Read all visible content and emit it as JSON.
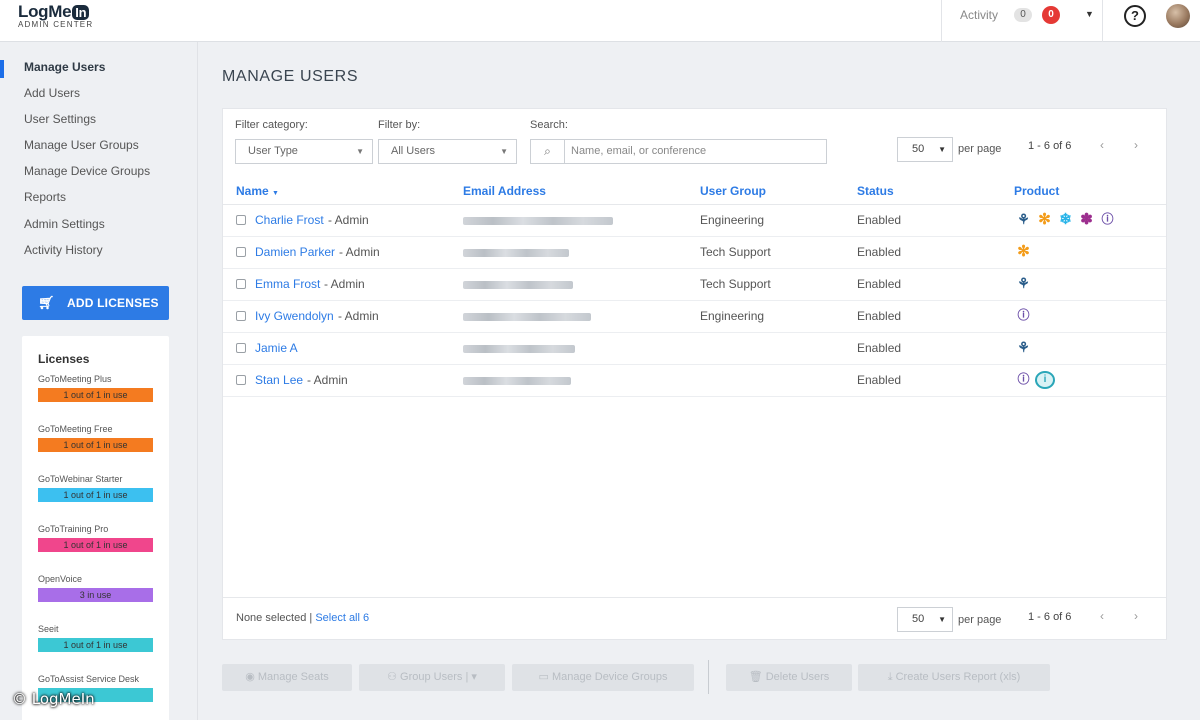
{
  "app": {
    "logo_main": "LogMe",
    "logo_in": "In",
    "logo_sub": "ADMIN CENTER"
  },
  "header": {
    "activity_label": "Activity",
    "activity_count": "0",
    "alert_count": "0",
    "help_glyph": "?"
  },
  "sidebar": {
    "items": [
      {
        "label": "Manage Users"
      },
      {
        "label": "Add Users"
      },
      {
        "label": "User Settings"
      },
      {
        "label": "Manage User Groups"
      },
      {
        "label": "Manage Device Groups"
      },
      {
        "label": "Reports"
      },
      {
        "label": "Admin Settings"
      },
      {
        "label": "Activity History"
      }
    ],
    "active_index": 0,
    "add_licenses_label": "ADD LICENSES"
  },
  "licenses": {
    "title": "Licenses",
    "items": [
      {
        "name": "GoToMeeting Plus",
        "usage": "1 out of 1 in use",
        "color": "#f47b20"
      },
      {
        "name": "GoToMeeting Free",
        "usage": "1 out of 1 in use",
        "color": "#f47b20"
      },
      {
        "name": "GoToWebinar Starter",
        "usage": "1 out of 1 in use",
        "color": "#3cc0f0"
      },
      {
        "name": "GoToTraining Pro",
        "usage": "1 out of 1 in use",
        "color": "#f0468c"
      },
      {
        "name": "OpenVoice",
        "usage": "3 in use",
        "color": "#a86ee8"
      },
      {
        "name": "Seeit",
        "usage": "1 out of 1 in use",
        "color": "#3cc8d4"
      },
      {
        "name": "GoToAssist Service Desk",
        "usage": "",
        "color": "#3cc8d4"
      }
    ]
  },
  "main": {
    "title": "MANAGE USERS",
    "filter_category_label": "Filter category:",
    "filter_category_value": "User Type",
    "filter_by_label": "Filter by:",
    "filter_by_value": "All Users",
    "search_label": "Search:",
    "search_placeholder": "Name, email, or conference",
    "per_page_value": "50",
    "per_page_label": "per page",
    "range": "1 - 6 of 6",
    "prev": "‹",
    "next": "›",
    "columns": {
      "name": "Name",
      "email": "Email Address",
      "group": "User Group",
      "status": "Status",
      "product": "Product"
    },
    "rows": [
      {
        "name": "Charlie Frost",
        "role": "- Admin",
        "group": "Engineering",
        "status": "Enabled",
        "products": [
          "gotomeeting",
          "gotowebinar-orange",
          "gotowebinar-cyan",
          "gototraining",
          "openvoice"
        ]
      },
      {
        "name": "Damien Parker",
        "role": "- Admin",
        "group": "Tech Support",
        "status": "Enabled",
        "products": [
          "gotowebinar-orange"
        ]
      },
      {
        "name": "Emma Frost",
        "role": "- Admin",
        "group": "Tech Support",
        "status": "Enabled",
        "products": [
          "gotomeeting"
        ]
      },
      {
        "name": "Ivy Gwendolyn",
        "role": "- Admin",
        "group": "Engineering",
        "status": "Enabled",
        "products": [
          "openvoice"
        ]
      },
      {
        "name": "Jamie A",
        "role": "",
        "group": "",
        "status": "Enabled",
        "products": [
          "gotomeeting"
        ]
      },
      {
        "name": "Stan Lee",
        "role": "- Admin",
        "group": "",
        "status": "Enabled",
        "products": [
          "openvoice",
          "seeit"
        ]
      }
    ],
    "selection_text": "None selected",
    "select_all": "Select all 6"
  },
  "actions": {
    "manage_seats": "Manage Seats",
    "group_users": "Group Users",
    "manage_device_groups": "Manage Device Groups",
    "delete_users": "Delete Users",
    "create_report": "Create Users Report (xls)"
  },
  "watermark": "© LogMeIn"
}
